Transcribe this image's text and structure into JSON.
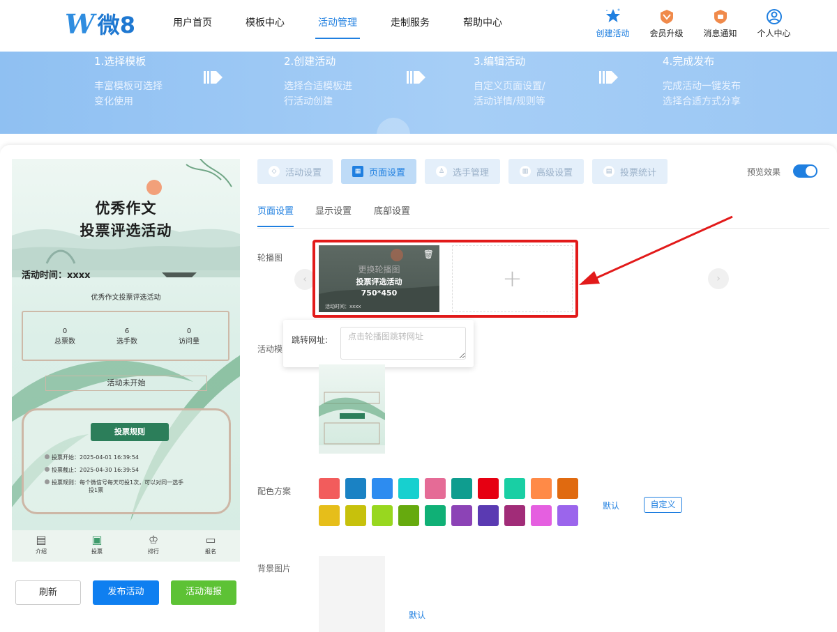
{
  "header": {
    "logo_mark": "W",
    "logo_text": "微8",
    "nav": [
      "用户首页",
      "模板中心",
      "活动管理",
      "走制服务",
      "帮助中心"
    ],
    "nav_active": "活动管理",
    "tools": [
      {
        "label": "创建活动",
        "icon": "star-icon"
      },
      {
        "label": "会员升级",
        "icon": "vip-badge-icon"
      },
      {
        "label": "消息通知",
        "icon": "notification-icon"
      },
      {
        "label": "个人中心",
        "icon": "user-icon"
      }
    ]
  },
  "steps": [
    {
      "title": "1.选择模板",
      "desc1": "丰富模板可选择",
      "desc2": "变化使用"
    },
    {
      "title": "2.创建活动",
      "desc1": "选择合适模板进",
      "desc2": "行活动创建"
    },
    {
      "title": "3.编辑活动",
      "desc1": "自定义页面设置/",
      "desc2": "活动详情/规则等"
    },
    {
      "title": "4.完成发布",
      "desc1": "完成活动一键发布",
      "desc2": "选择合适方式分享"
    }
  ],
  "phone": {
    "title1": "优秀作文",
    "title2": "投票评选活动",
    "time_label": "活动时间：xxxx",
    "subtitle": "优秀作文投票评选活动",
    "stats": [
      {
        "value": "0",
        "label": "总票数"
      },
      {
        "value": "6",
        "label": "选手数"
      },
      {
        "value": "0",
        "label": "访问量"
      }
    ],
    "status": "活动未开始",
    "rules_button": "投票规则",
    "rules": [
      "投票开始：2025-04-01 16:39:54",
      "投票截止：2025-04-30 16:39:54",
      "投票规则：每个微信号每天可投1次，可以对同一选手",
      "投1票"
    ],
    "tabs": [
      {
        "label": "介绍",
        "icon": "document-icon"
      },
      {
        "label": "投票",
        "icon": "gift-icon"
      },
      {
        "label": "排行",
        "icon": "crown-icon"
      },
      {
        "label": "报名",
        "icon": "signup-icon"
      }
    ]
  },
  "actions": {
    "refresh": "刷新",
    "publish": "发布活动",
    "poster": "活动海报"
  },
  "tabs": [
    {
      "label": "活动设置",
      "icon": "shield-icon"
    },
    {
      "label": "页面设置",
      "icon": "layout-icon"
    },
    {
      "label": "选手管理",
      "icon": "person-icon"
    },
    {
      "label": "高级设置",
      "icon": "settings-icon"
    },
    {
      "label": "投票统计",
      "icon": "chart-icon"
    }
  ],
  "active_tab": "页面设置",
  "preview_label": "预览效果",
  "preview_on": true,
  "subtabs": [
    "页面设置",
    "显示设置",
    "底部设置"
  ],
  "labels": {
    "carousel": "轮播图",
    "template": "活动模",
    "color": "配色方案",
    "background": "背景图片"
  },
  "carousel": {
    "overlay_text": "更换轮播图",
    "image_title": "投票评选活动",
    "image_size": "750*450",
    "image_time": "活动时间：xxxx",
    "add_symbol": "+",
    "prev": "‹",
    "next": "›"
  },
  "jump": {
    "label": "跳转网址:",
    "placeholder": "点击轮播图跳转网址"
  },
  "colors": {
    "row1": [
      "#f25c5c",
      "#1a82c4",
      "#2d8cf0",
      "#17d0cf",
      "#e56b96",
      "#0f9d8f",
      "#e60012",
      "#19cfa4",
      "#ff8a47",
      "#e06a10"
    ],
    "row2": [
      "#e6be1a",
      "#c7c10c",
      "#98d71f",
      "#66aa0e",
      "#10b076",
      "#8c43b6",
      "#5a3ab2",
      "#a12c78",
      "#e55fe0",
      "#9b65ec"
    ]
  },
  "color_default": "默认",
  "color_custom": "自定义",
  "bg_default": "默认",
  "accent": "#1f7fe0",
  "highlight": "#e21a1a"
}
